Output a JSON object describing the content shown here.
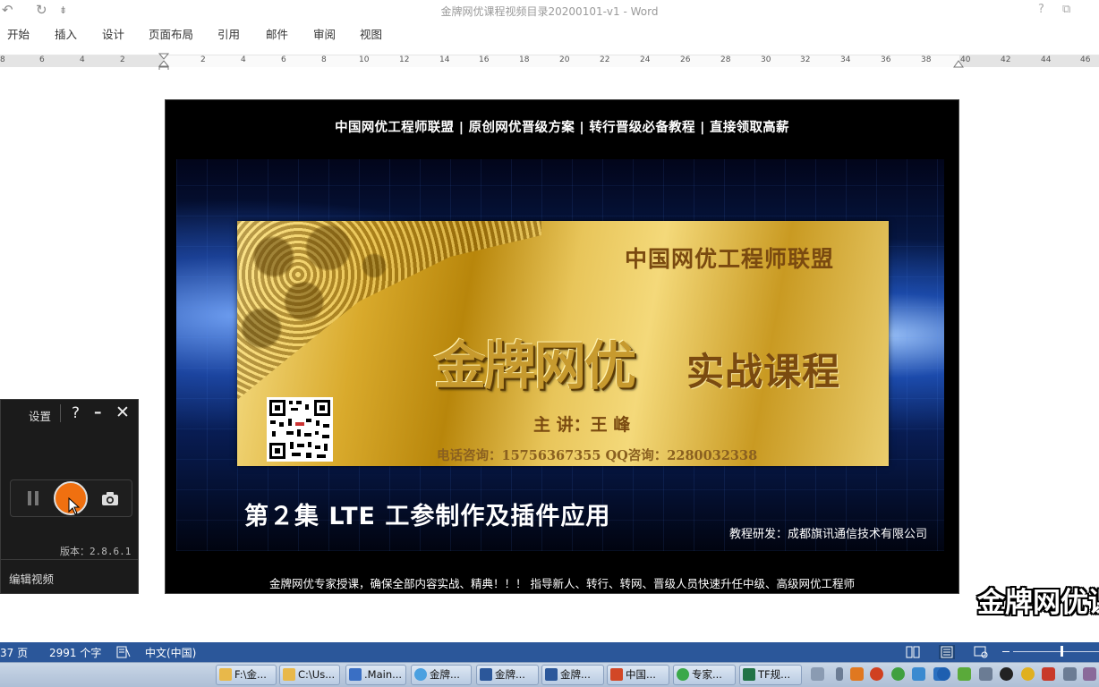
{
  "window": {
    "title": "金牌网优课程视频目录20200101-v1 - Word",
    "help_glyph": "?",
    "restore_glyph": "⧉",
    "undo_glyph": "↶",
    "redo_glyph": "↻",
    "customize_glyph": "⇟"
  },
  "ribbon": {
    "tabs": [
      "开始",
      "插入",
      "设计",
      "页面布局",
      "引用",
      "邮件",
      "审阅",
      "视图"
    ]
  },
  "ruler": {
    "labels": [
      "8",
      "6",
      "4",
      "2",
      "2",
      "4",
      "6",
      "8",
      "10",
      "12",
      "14",
      "16",
      "18",
      "20",
      "22",
      "24",
      "26",
      "28",
      "30",
      "32",
      "34",
      "36",
      "38",
      "40",
      "42",
      "44",
      "46"
    ]
  },
  "slide": {
    "top_banner": "中国网优工程师联盟 | 原创网优晋级方案 | 转行晋级必备教程 | 直接领取高薪",
    "alliance": "中国网优工程师联盟",
    "title_big": "金牌网优",
    "title_small": "实战课程",
    "speaker": "主 讲：王  峰",
    "phone": "电话咨询：15756367355   QQ咨询：2280032338",
    "episode": "第２集   LTE 工参制作及插件应用",
    "research": "教程研发：成都旗讯通信技术有限公司",
    "bottom_banner": "金牌网优专家授课，确保全部内容实战、精典！！！ 指导新人、转行、转网、晋级人员快速升任中级、高级网优工程师"
  },
  "watermark": "金牌网优课",
  "recorder": {
    "settings_label": "设置",
    "help_glyph": "?",
    "minimize_glyph": "–",
    "close_glyph": "✕",
    "version": "版本：2.8.6.1",
    "edit_video": "编辑视频",
    "record_color": "#f07010"
  },
  "status_bar": {
    "page": "37 页",
    "words": "2991 个字",
    "language": "中文(中国)"
  },
  "taskbar": {
    "items": [
      {
        "label": "F:\\金...",
        "icon": "folder-icon",
        "color": "#e8b84a"
      },
      {
        "label": "C:\\Us...",
        "icon": "folder-icon",
        "color": "#e8b84a"
      },
      {
        "label": ".Main...",
        "icon": "app-icon",
        "color": "#3a6fc4"
      },
      {
        "label": "金牌...",
        "icon": "browser-icon",
        "color": "#4aa0e0"
      },
      {
        "label": "金牌...",
        "icon": "word-icon",
        "color": "#2b579a"
      },
      {
        "label": "金牌...",
        "icon": "word-icon",
        "color": "#2b579a"
      },
      {
        "label": "中国...",
        "icon": "powerpoint-icon",
        "color": "#d24726"
      },
      {
        "label": "专家...",
        "icon": "chat-icon",
        "color": "#3aa84a"
      },
      {
        "label": "TF规...",
        "icon": "excel-icon",
        "color": "#217346"
      }
    ]
  }
}
